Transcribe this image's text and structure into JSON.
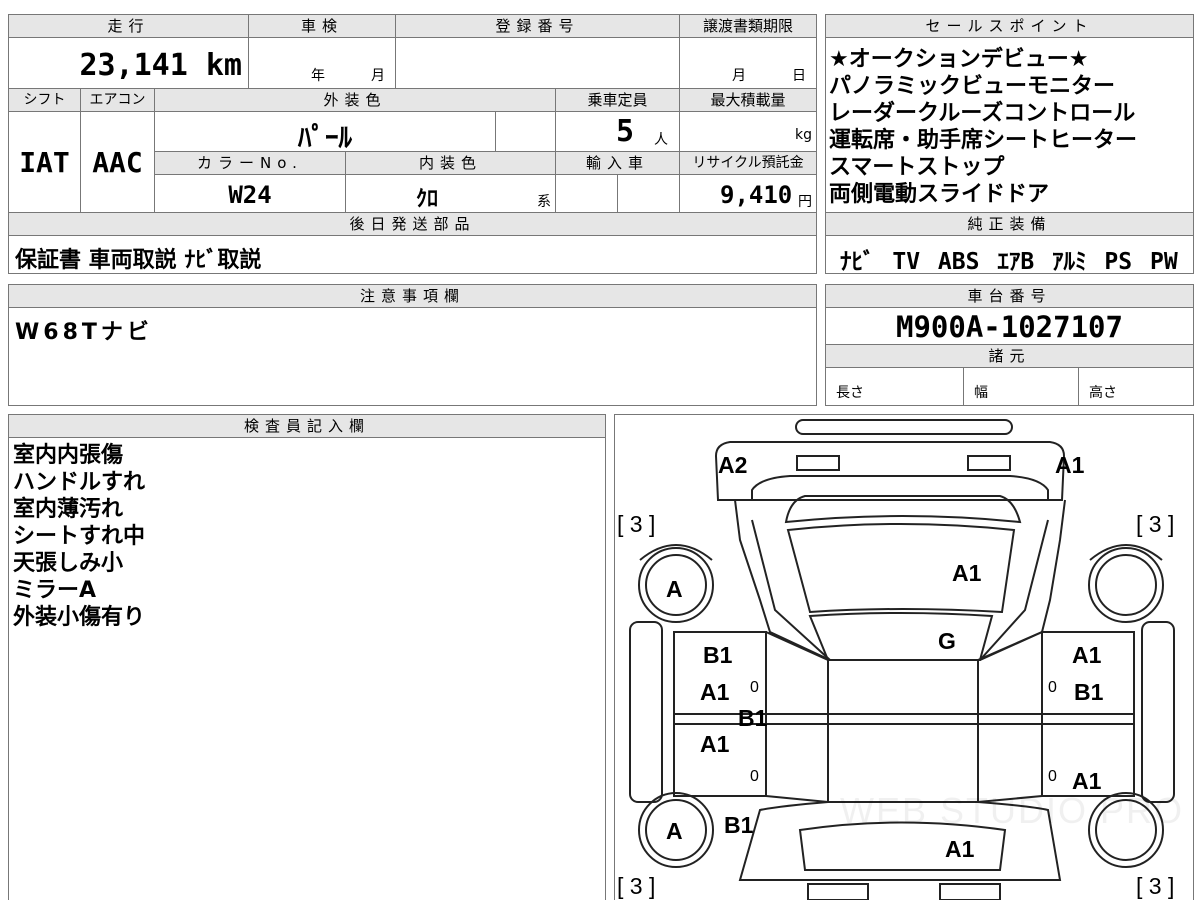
{
  "sheet": {
    "mileage": {
      "label": "走行",
      "value": "23,141 km"
    },
    "inspection": {
      "label": "車検",
      "year_unit": "年",
      "month_unit": "月"
    },
    "registration": {
      "label": "登録番号"
    },
    "transfer_deadline": {
      "label": "譲渡書類期限",
      "month_unit": "月",
      "day_unit": "日"
    },
    "shift": {
      "label": "シフト",
      "value": "IAT"
    },
    "aircon": {
      "label": "エアコン",
      "value": "AAC"
    },
    "exterior_color": {
      "label": "外装色",
      "value": "ﾊﾟｰﾙ"
    },
    "capacity": {
      "label": "乗車定員",
      "value": "5",
      "unit": "人"
    },
    "max_load": {
      "label": "最大積載量",
      "unit": "kg"
    },
    "color_no": {
      "label": "カラーNo.",
      "value": "W24"
    },
    "interior_color": {
      "label": "内装色",
      "value": "ｸﾛ",
      "suffix": "系"
    },
    "import": {
      "label": "輸入車"
    },
    "recycle": {
      "label": "リサイクル預託金",
      "value": "9,410",
      "unit": "円"
    },
    "later_parts": {
      "label": "後日発送部品",
      "value": "保証書 車両取説 ﾅﾋﾞ取説"
    },
    "notes": {
      "label": "注意事項欄",
      "value": "W68Tナビ"
    },
    "inspector": {
      "label": "検査員記入欄",
      "lines": [
        "室内内張傷",
        "ハンドルすれ",
        "室内薄汚れ",
        "シートすれ中",
        "天張しみ小",
        "ミラーA",
        "外装小傷有り"
      ]
    },
    "sales_points": {
      "label": "セールスポイント",
      "lines": [
        "★オークションデビュー★",
        "パノラミックビューモニター",
        "レーダークルーズコントロール",
        "運転席・助手席シートヒーター",
        "スマートストップ",
        "両側電動スライドドア"
      ]
    },
    "equipment": {
      "label": "純正装備",
      "items": [
        "ﾅﾋﾞ",
        "TV",
        "ABS",
        "ｴｱB",
        "ｱﾙﾐ",
        "PS",
        "PW"
      ]
    },
    "chassis": {
      "label": "車台番号",
      "value": "M900A-1027107"
    },
    "specs": {
      "label": "諸元",
      "length": "長さ",
      "width": "幅",
      "height": "高さ"
    }
  },
  "diagram": {
    "grades": [
      "A2",
      "A1",
      "[ 3 ]",
      "[ 3 ]",
      "A1",
      "A",
      "G",
      "B1",
      "A1",
      "A1",
      "B1",
      "B1",
      "A1",
      "A1",
      "A1",
      "A",
      "B1",
      "A1",
      "[ 3 ]",
      "[ 3 ]"
    ],
    "marks": [
      "0",
      "0",
      "0",
      "0"
    ],
    "watermark": "WEB STUDIO PRO"
  }
}
